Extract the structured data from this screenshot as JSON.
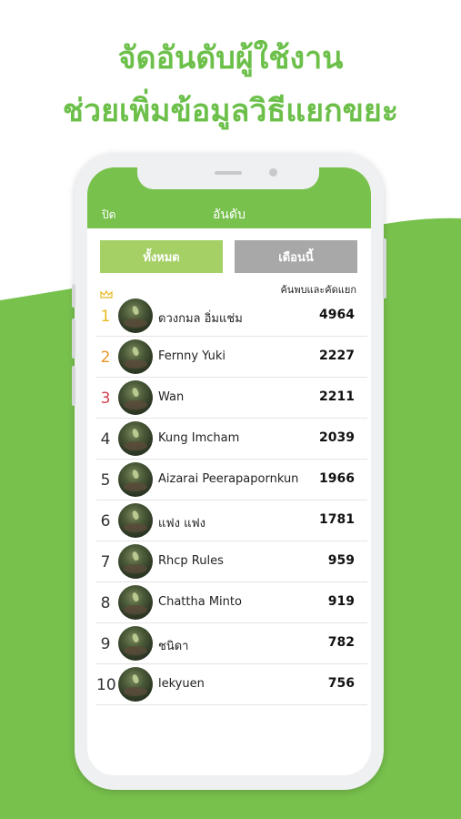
{
  "headline": {
    "line1": "จัดอันดับผู้ใช้งาน",
    "line2": "ช่วยเพิ่มข้อมูลวิธีแยกขยะ"
  },
  "colors": {
    "brand_green": "#6cc04a",
    "appbar_green": "#78c14d",
    "tab_active": "#a5d065",
    "tab_inactive": "#a8a8a8",
    "rank1": "#e7b91e",
    "rank2": "#e8962b",
    "rank3": "#d2424f"
  },
  "appbar": {
    "close_label": "ปิด",
    "title": "อันดับ"
  },
  "tabs": {
    "all_label": "ทั้งหมด",
    "month_label": "เดือนนี้"
  },
  "column_header": "ค้นพบและคัดแยก",
  "leaderboard": [
    {
      "rank": "1",
      "name": "ดวงกมล อิ่มแช่ม",
      "score": "4964"
    },
    {
      "rank": "2",
      "name": "Fernny Yuki",
      "score": "2227"
    },
    {
      "rank": "3",
      "name": "Wan",
      "score": "2211"
    },
    {
      "rank": "4",
      "name": "Kung Imcham",
      "score": "2039"
    },
    {
      "rank": "5",
      "name": "Aizarai Peerapapornkun",
      "score": "1966"
    },
    {
      "rank": "6",
      "name": "แฟง แฟง",
      "score": "1781"
    },
    {
      "rank": "7",
      "name": "Rhcp Rules",
      "score": "959"
    },
    {
      "rank": "8",
      "name": "Chattha Minto",
      "score": "919"
    },
    {
      "rank": "9",
      "name": "ชนิดา",
      "score": "782"
    },
    {
      "rank": "10",
      "name": "lekyuen",
      "score": "756"
    }
  ]
}
